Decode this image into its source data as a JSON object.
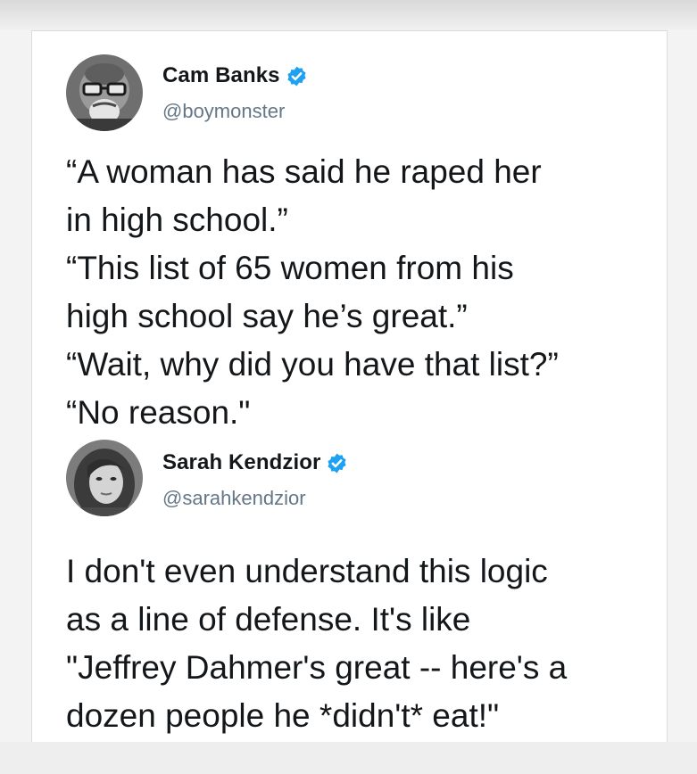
{
  "tweets": [
    {
      "author_name": "Cam Banks",
      "handle": "@boymonster",
      "verified": true,
      "lines": [
        "“A woman has said he raped her",
        "in high school.”",
        "“This list of 65 women from his",
        "high school say he’s great.”",
        "“Wait, why did you have that list?”",
        "“No reason.\""
      ]
    },
    {
      "author_name": "Sarah Kendzior",
      "handle": "@sarahkendzior",
      "verified": true,
      "lines": [
        "I don't even understand this logic",
        "as a line of defense. It's like",
        "\"Jeffrey Dahmer's great -- here's a",
        "dozen people he *didn't* eat!\""
      ]
    }
  ],
  "colors": {
    "verified_badge": "#1da1f2",
    "handle": "#657786",
    "text": "#14171a"
  },
  "icons": {
    "verified": "verified-badge-icon"
  }
}
